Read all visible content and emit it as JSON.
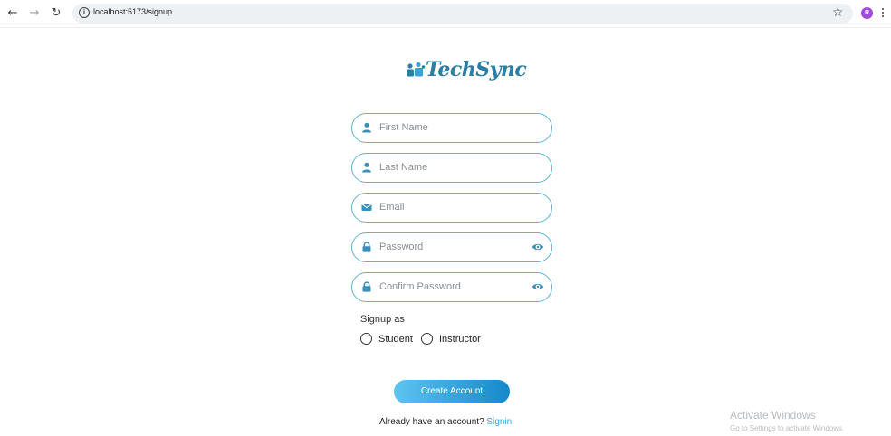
{
  "browser": {
    "url": "localhost:5173/signup",
    "avatar_letter": "R",
    "avatar_color": "#a04cd6"
  },
  "brand": {
    "name": "TechSync",
    "color": "#2c7fa3"
  },
  "form": {
    "first_name_placeholder": "First Name",
    "last_name_placeholder": "Last Name",
    "email_placeholder": "Email",
    "password_placeholder": "Password",
    "confirm_password_placeholder": "Confirm Password",
    "signup_as_label": "Signup as",
    "roles": [
      "Student",
      "Instructor"
    ],
    "submit_label": "Create Account",
    "already_text": "Already have an account?",
    "signin_link": "Signin"
  },
  "colors": {
    "field_border": "#5fb3d4",
    "icon": "#3d8fb8",
    "button_start": "#5ec4f0",
    "button_end": "#1688c9",
    "link": "#3aa3d6"
  },
  "watermark": {
    "title": "Activate Windows",
    "subtitle": "Go to Settings to activate Windows."
  }
}
